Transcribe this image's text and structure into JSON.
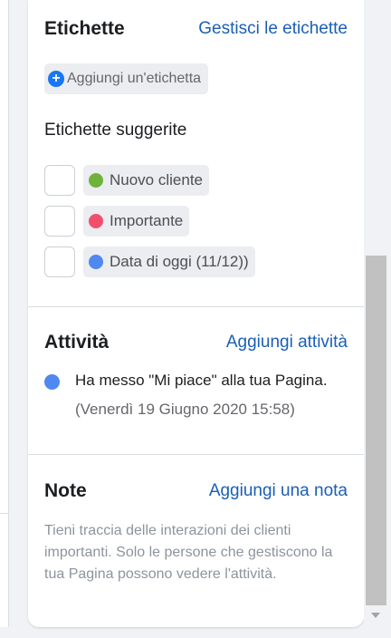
{
  "labels": {
    "title": "Etichette",
    "manage_link": "Gestisci le etichette",
    "add_button": "Aggiungi un'etichetta",
    "suggested_title": "Etichette suggerite",
    "suggested": [
      {
        "text": "Nuovo cliente",
        "color": "#6fb33a",
        "checked": false
      },
      {
        "text": "Importante",
        "color": "#f0506e",
        "checked": false
      },
      {
        "text": "Data di oggi (11/12))",
        "color": "#4f88f0",
        "checked": false
      }
    ]
  },
  "activity": {
    "title": "Attività",
    "add_link": "Aggiungi attività",
    "items": [
      {
        "text": "Ha messo \"Mi piace\" alla tua Pagina.",
        "time": "(Venerdì 19 Giugno 2020 15:58)",
        "dot_color": "#4f88f0"
      }
    ]
  },
  "notes": {
    "title": "Note",
    "add_link": "Aggiungi una nota",
    "empty_text": "Tieni traccia delle interazioni dei clienti importanti. Solo le persone che gestiscono la tua Pagina possono vedere l'attività."
  },
  "colors": {
    "accent_link": "#1b5fb5",
    "accent_blue": "#1877f2",
    "background": "#f0f2f5"
  },
  "icons": {
    "add": "plus-circle-icon",
    "scroll_down": "scroll-down-arrow-icon"
  }
}
